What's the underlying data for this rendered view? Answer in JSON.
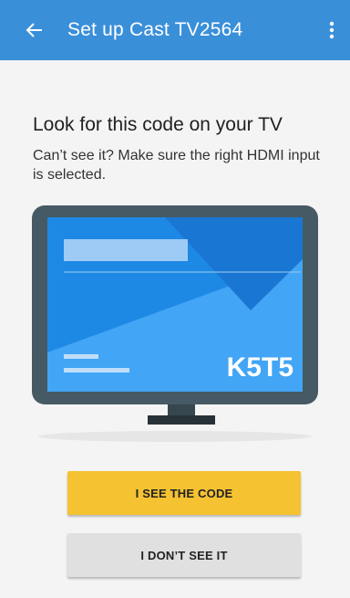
{
  "appbar": {
    "back_icon": "arrow-back-icon",
    "title": "Set up Cast TV2564",
    "menu_icon": "more-vert-icon",
    "color": "#3a8fd9"
  },
  "content": {
    "heading": "Look for this code on your TV",
    "subtext": "Can’t see it? Make sure the right HDMI input is selected."
  },
  "tv": {
    "code": "K5T5",
    "screen_color": "#1e88e5",
    "bezel_color": "#455a64"
  },
  "buttons": {
    "primary_label": "I SEE THE CODE",
    "primary_color": "#f5c232",
    "secondary_label": "I DON’T SEE IT",
    "secondary_color": "#e0e0e0"
  }
}
